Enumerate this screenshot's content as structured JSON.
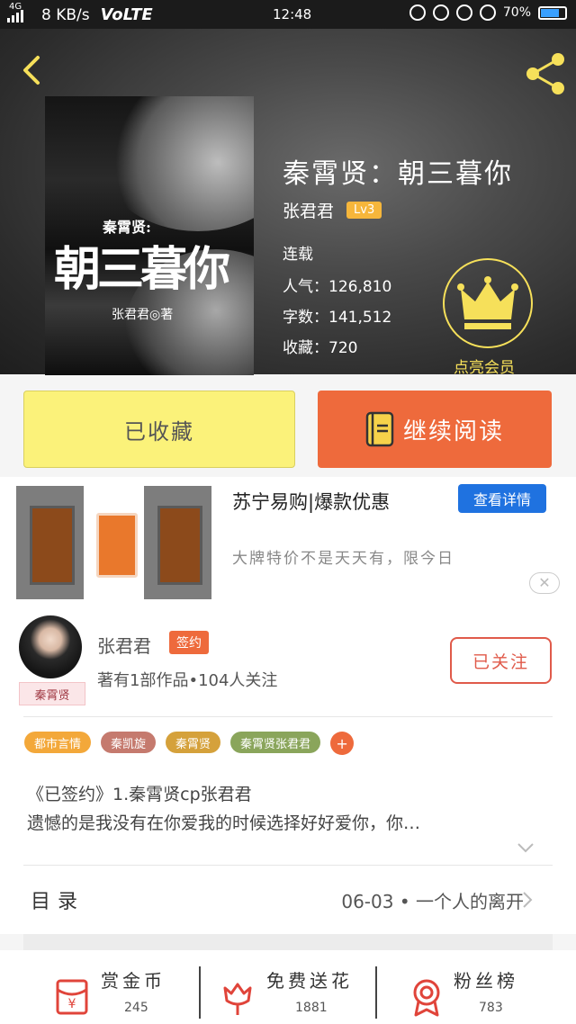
{
  "status_bar": {
    "network": "4G",
    "speed": "8 KB/s",
    "volte": "VoLTE",
    "time": "12:48",
    "battery": "70%"
  },
  "header": {
    "cover": {
      "subtitle": "秦霄贤:",
      "title": "朝三暮你",
      "author": "张君君◎著"
    },
    "book_title": "秦霄贤：朝三暮你",
    "author": "张君君",
    "level": "Lv3",
    "status": "连载",
    "popularity": "人气：126,810",
    "word_count": "字数：141,512",
    "favorites": "收藏：720",
    "vip_label": "点亮会员"
  },
  "actions": {
    "collect_label": "已收藏",
    "read_label": "继续阅读"
  },
  "ad": {
    "title": "苏宁易购|爆款优惠",
    "detail_label": "查看详情",
    "description": "大牌特价不是天天有，限今日",
    "close": "✕"
  },
  "author_section": {
    "avatar_tag": "秦霄贤",
    "name": "张君君",
    "sign_badge": "签约",
    "info": "著有1部作品•104人关注",
    "follow_label": "已关注"
  },
  "tags": [
    {
      "label": "都市言情",
      "color": "#f3a83a"
    },
    {
      "label": "秦凯旋",
      "color": "#c57a6e"
    },
    {
      "label": "秦霄贤",
      "color": "#d5a13b"
    },
    {
      "label": "秦霄贤张君君",
      "color": "#8aa55b"
    }
  ],
  "tag_add": "+",
  "description": {
    "line1": "《已签约》1.秦霄贤cp张君君",
    "line2": "遗憾的是我没有在你爱我的时候选择好好爱你，你…"
  },
  "catalog": {
    "label": "目录",
    "latest": "06-03 • 一个人的离开"
  },
  "bottom_bar": {
    "reward": {
      "label": "赏金币",
      "count": "245"
    },
    "flower": {
      "label": "免费送花",
      "count": "1881"
    },
    "fans": {
      "label": "粉丝榜",
      "count": "783"
    }
  },
  "colors": {
    "accent_orange": "#ee6a3c",
    "collect_yellow": "#fbf27a",
    "vip_gold": "#f6e05a",
    "ad_blue": "#1f72e0",
    "icon_red": "#e0443a"
  }
}
